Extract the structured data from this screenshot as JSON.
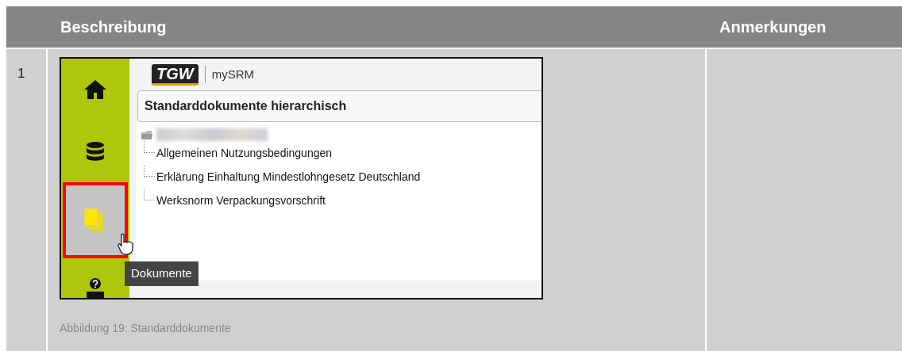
{
  "table": {
    "columns": [
      "Beschreibung",
      "Anmerkungen"
    ],
    "rows": [
      {
        "number": "1",
        "screenshot": {
          "logo": "TGW",
          "app_name": "mySRM",
          "sidebar": [
            {
              "kind": "home",
              "selected": false,
              "highlighted": false
            },
            {
              "kind": "database",
              "selected": false,
              "highlighted": false
            },
            {
              "kind": "documents",
              "selected": true,
              "highlighted": true
            },
            {
              "kind": "help",
              "selected": false,
              "highlighted": false
            }
          ],
          "panel_title": "Standarddokumente hierarchisch",
          "tree": {
            "children": [
              {
                "label": "Allgemeinen Nutzungsbedingungen"
              },
              {
                "label": "Erklärung Einhaltung Mindestlohngesetz Deutschland"
              },
              {
                "label": "Werksnorm Verpackungsvorschrift"
              }
            ]
          },
          "tooltip": "Dokumente"
        },
        "caption": "Abbildung 19: Standarddokumente"
      }
    ]
  }
}
